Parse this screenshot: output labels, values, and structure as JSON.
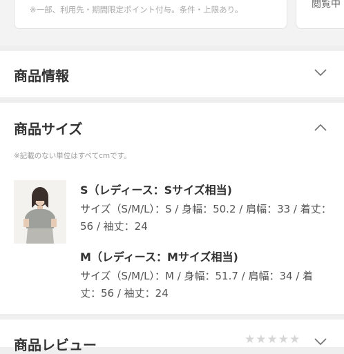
{
  "notice": {
    "text": "※一部、利用先・期間限定ポイント付与。条件・上限あり。"
  },
  "side_card": {
    "text": "閲覧中"
  },
  "sections": {
    "info": {
      "title": "商品情報"
    },
    "size": {
      "title": "商品サイズ",
      "note": "※記載のない単位はすべてcmです。",
      "entries": [
        {
          "title": "S（レディース：Sサイズ相当)",
          "detail": "サイズ（S/M/L）：S / 身幅：50.2 / 肩幅：33 / 着丈：56 / 袖丈：24"
        },
        {
          "title": "M（レディース：Mサイズ相当)",
          "detail": "サイズ（S/M/L）：M / 身幅：51.7 / 肩幅：34 / 着丈：56 / 袖丈：24"
        }
      ]
    },
    "review": {
      "title": "商品レビュー",
      "stars": "★★★★★"
    }
  },
  "icons": {
    "collapse": "chevron-down-icon",
    "expand": "chevron-up-icon"
  },
  "colors": {
    "page_bg": "#efefef",
    "card_bg": "#ffffff",
    "star_empty": "#d6d6d6"
  }
}
